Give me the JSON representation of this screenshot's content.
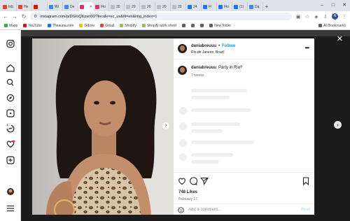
{
  "browser": {
    "tabs": [
      {
        "label": "Inb",
        "color": "#ea4335"
      },
      {
        "label": "He",
        "color": "#ea4335"
      },
      {
        "label": "",
        "color": "#ff0000"
      },
      {
        "label": "Wi",
        "color": "#4285f4"
      },
      {
        "label": "De",
        "color": "#4285f4"
      },
      {
        "label": "",
        "color": "#e1306c",
        "active": true
      },
      {
        "label": "Flo",
        "color": "#e1306c"
      },
      {
        "label": "20",
        "color": "#bdbdbd"
      },
      {
        "label": "20",
        "color": "#bdbdbd"
      },
      {
        "label": "20",
        "color": "#bdbdbd"
      },
      {
        "label": "20",
        "color": "#bdbdbd"
      },
      {
        "label": "20",
        "color": "#bdbdbd"
      },
      {
        "label": "24",
        "color": "#1877f2"
      },
      {
        "label": "Fl",
        "color": "#1877f2"
      },
      {
        "label": "Flo",
        "color": "#1877f2"
      },
      {
        "label": "(1)",
        "color": "#1877f2"
      },
      {
        "label": "Da",
        "color": "#4285f4"
      }
    ],
    "url": "instagram.com/p/DGIoQKpsn00/?locale=ec_us&hl=en&img_index=1",
    "bookmarks": [
      {
        "label": "Maps",
        "color": "#34a853"
      },
      {
        "label": "YouTube",
        "color": "#ff0000"
      },
      {
        "label": "Theauna.com",
        "color": "#1a73e8"
      },
      {
        "label": "Gdrive",
        "color": "#fbbc04"
      },
      {
        "label": "Gmail",
        "color": "#ea4335"
      },
      {
        "label": "Shopify",
        "color": "#95bf47"
      },
      {
        "label": "Shopify work sheet",
        "color": "#95bf47"
      },
      {
        "label": "",
        "color": "#5f6368"
      },
      {
        "label": "",
        "color": "#5f6368"
      },
      {
        "label": "",
        "color": "#5f6368"
      },
      {
        "label": "New folder",
        "color": "#5f6368"
      }
    ],
    "all_bookmarks": "All Bookmarks",
    "profile_initial": "N"
  },
  "post": {
    "username": "daniabreuuu",
    "follow_label": "Follow",
    "location": "Rio de Janeiro, Brazil",
    "caption": "Party in Rio?",
    "caption_age": "7 weeks",
    "likes": "748 Likes",
    "date": "February 17",
    "comment_placeholder": "Add a comment...",
    "post_label": "Post"
  },
  "colors": {
    "accent": "#0095f6",
    "backdrop": "#4b4b4b"
  }
}
